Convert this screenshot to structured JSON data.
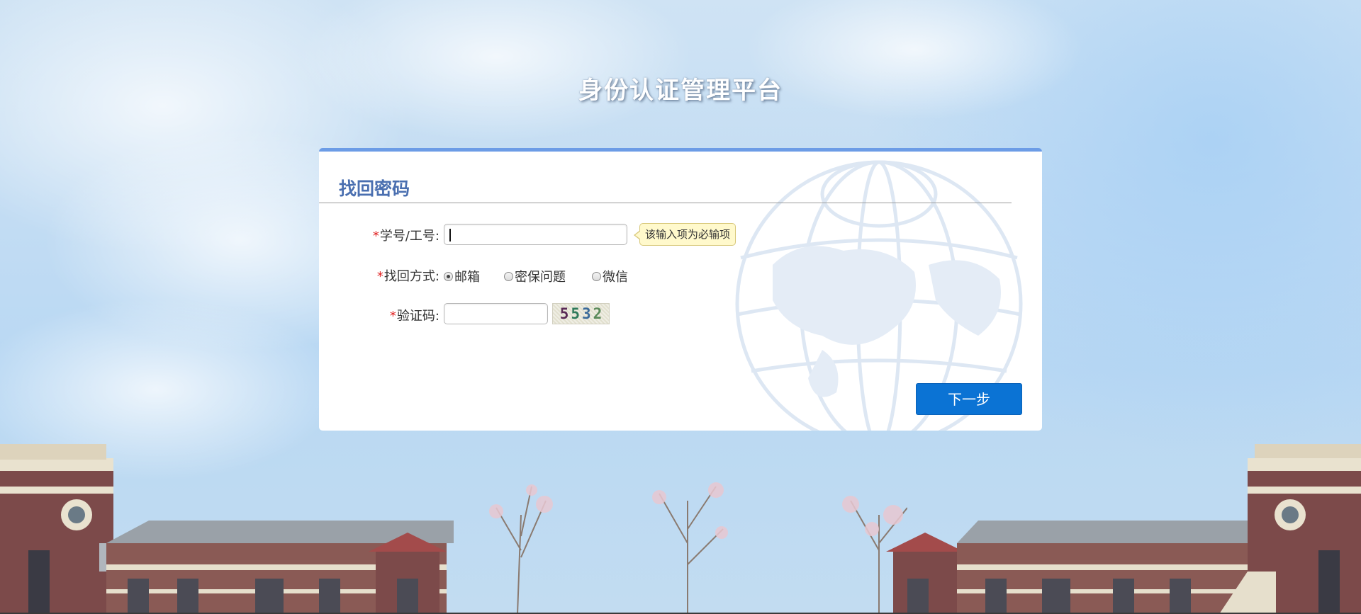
{
  "platform_title": "身份认证管理平台",
  "panel": {
    "title": "找回密码"
  },
  "form": {
    "required_mark": "*",
    "id_label": "学号/工号:",
    "id_value": "",
    "id_tooltip": "该输入项为必输项",
    "method_label": "找回方式:",
    "methods": [
      {
        "label": "邮箱",
        "checked": true
      },
      {
        "label": "密保问题",
        "checked": false
      },
      {
        "label": "微信",
        "checked": false
      }
    ],
    "captcha_label": "验证码:",
    "captcha_value": "",
    "captcha_digits": [
      "5",
      "5",
      "3",
      "2"
    ],
    "next_button": "下一步"
  },
  "colors": {
    "accent": "#0b73d4",
    "panel_border": "#6c9ce6",
    "title_blue": "#4a6fb0",
    "required_red": "#e02020",
    "tooltip_bg": "#fff9cc"
  }
}
